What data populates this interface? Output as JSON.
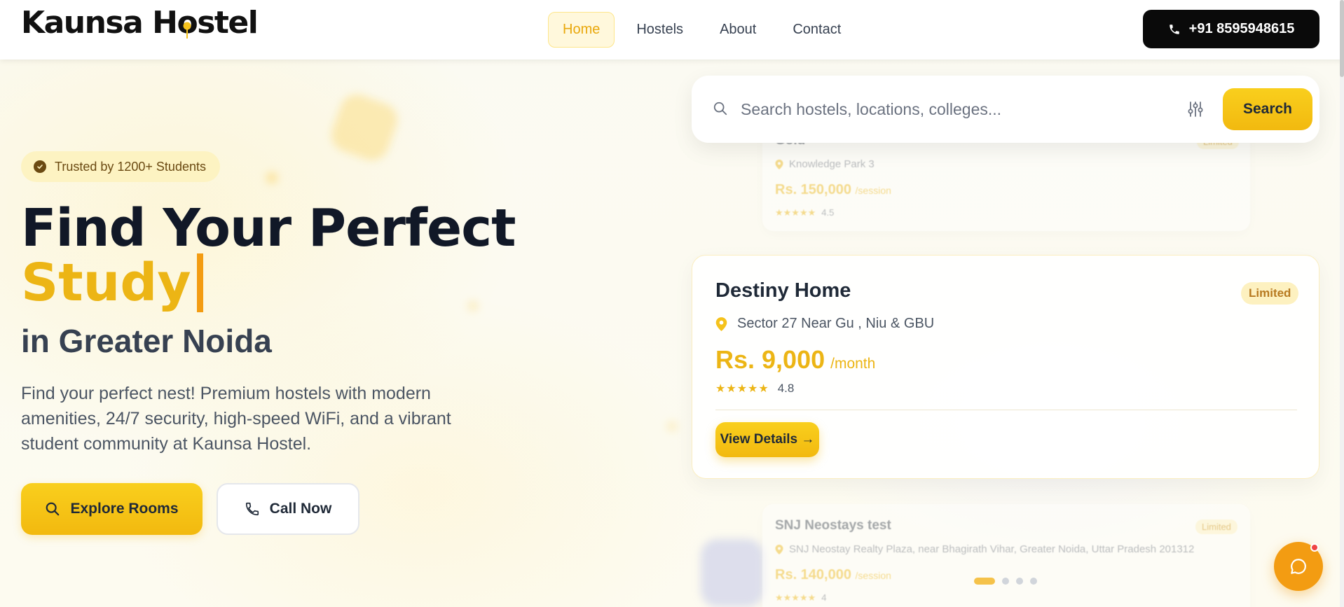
{
  "brand": {
    "logo_text_before": "Kaunsa H",
    "logo_o": "o",
    "logo_text_after": "stel"
  },
  "nav": {
    "items": [
      {
        "label": "Home",
        "active": true
      },
      {
        "label": "Hostels",
        "active": false
      },
      {
        "label": "About",
        "active": false
      },
      {
        "label": "Contact",
        "active": false
      }
    ],
    "phone_label": "+91 8595948615"
  },
  "hero": {
    "badge": "Trusted by 1200+ Students",
    "title_line1": "Find Your Perfect",
    "title_word": "Study",
    "subtitle": "in Greater Noida",
    "description": "Find your perfect nest! Premium hostels with modern amenities, 24/7 security, high-speed WiFi, and a vibrant student community at Kaunsa Hostel.",
    "explore_label": "Explore Rooms",
    "call_label": "Call Now"
  },
  "search": {
    "placeholder": "Search hostels, locations, colleges...",
    "value": "",
    "button_label": "Search"
  },
  "carousel": {
    "cards": [
      {
        "title": "Gold",
        "location": "Knowledge Park 3",
        "price": "Rs. 150,000",
        "price_unit": "/session",
        "rating": "4.5",
        "badge": "Limited",
        "state": "faded"
      },
      {
        "title": "Destiny Home",
        "location": "Sector 27 Near Gu , Niu & GBU",
        "price": "Rs. 9,000",
        "price_unit": "/month",
        "rating": "4.8",
        "badge": "Limited",
        "button_label": "View Details →",
        "state": "active"
      },
      {
        "title": "SNJ Neostays test",
        "location": "SNJ Neostay Realty Plaza, near Bhagirath Vihar, Greater Noida, Uttar Pradesh 201312",
        "price": "Rs. 140,000",
        "price_unit": "/session",
        "rating": "4",
        "badge": "Limited",
        "state": "faded"
      }
    ],
    "dots": 4,
    "active_dot": 0
  },
  "colors": {
    "accent": "#f2b90f",
    "accent_dark": "#f39c12",
    "text_dark": "#111827",
    "badge_bg": "#fdf3c2"
  },
  "icons": {
    "phone": "phone-icon",
    "check": "check-circle-icon",
    "search": "search-icon",
    "filter": "sliders-icon",
    "location": "map-pin-icon",
    "star": "star-icon",
    "chat": "chat-bubble-icon"
  }
}
